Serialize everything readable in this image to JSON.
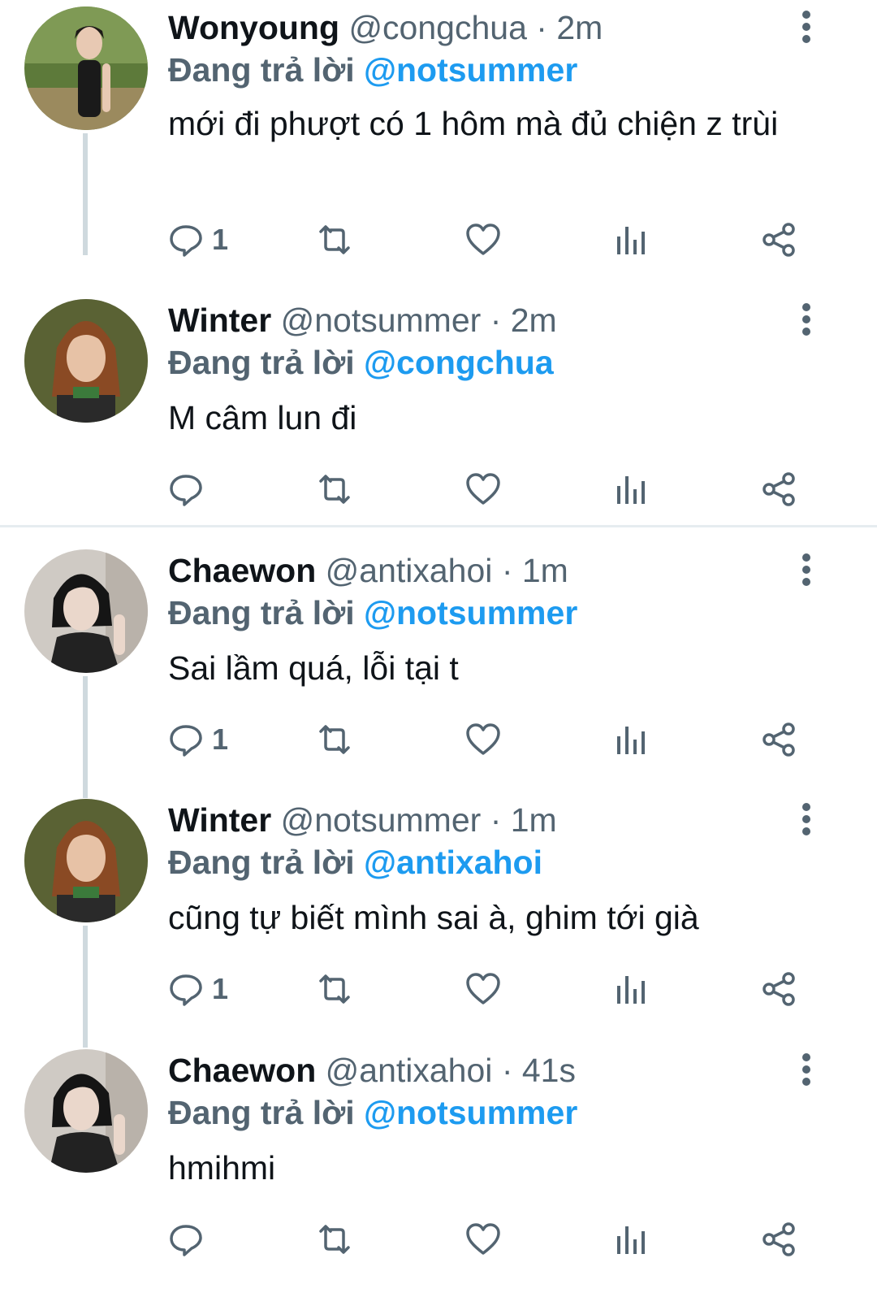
{
  "reply_prefix": "Đang trả lời",
  "tweets": [
    {
      "name": "Wonyoung",
      "handle": "@congchua",
      "time": "2m",
      "reply_to": "@notsummer",
      "text": "mới đi phượt có 1 hôm mà đủ chiện z trùi",
      "reply_count": "1",
      "avatar": "wonyoung-avatar"
    },
    {
      "name": "Winter",
      "handle": "@notsummer",
      "time": "2m",
      "reply_to": "@congchua",
      "text": "M câm lun đi",
      "reply_count": "",
      "avatar": "winter-avatar"
    },
    {
      "name": "Chaewon",
      "handle": "@antixahoi",
      "time": "1m",
      "reply_to": "@notsummer",
      "text": "Sai lầm quá, lỗi tại t",
      "reply_count": "1",
      "avatar": "chaewon-avatar"
    },
    {
      "name": "Winter",
      "handle": "@notsummer",
      "time": "1m",
      "reply_to": "@antixahoi",
      "text": "cũng tự biết mình sai à, ghim tới già",
      "reply_count": "1",
      "avatar": "winter-avatar"
    },
    {
      "name": "Chaewon",
      "handle": "@antixahoi",
      "time": "41s",
      "reply_to": "@notsummer",
      "text": "hmihmi",
      "reply_count": "",
      "avatar": "chaewon-avatar"
    }
  ],
  "colors": {
    "accent": "#1d9bf0",
    "secondary_text": "#536471",
    "primary_text": "#0f1419",
    "thread_line": "#cfd9de"
  }
}
